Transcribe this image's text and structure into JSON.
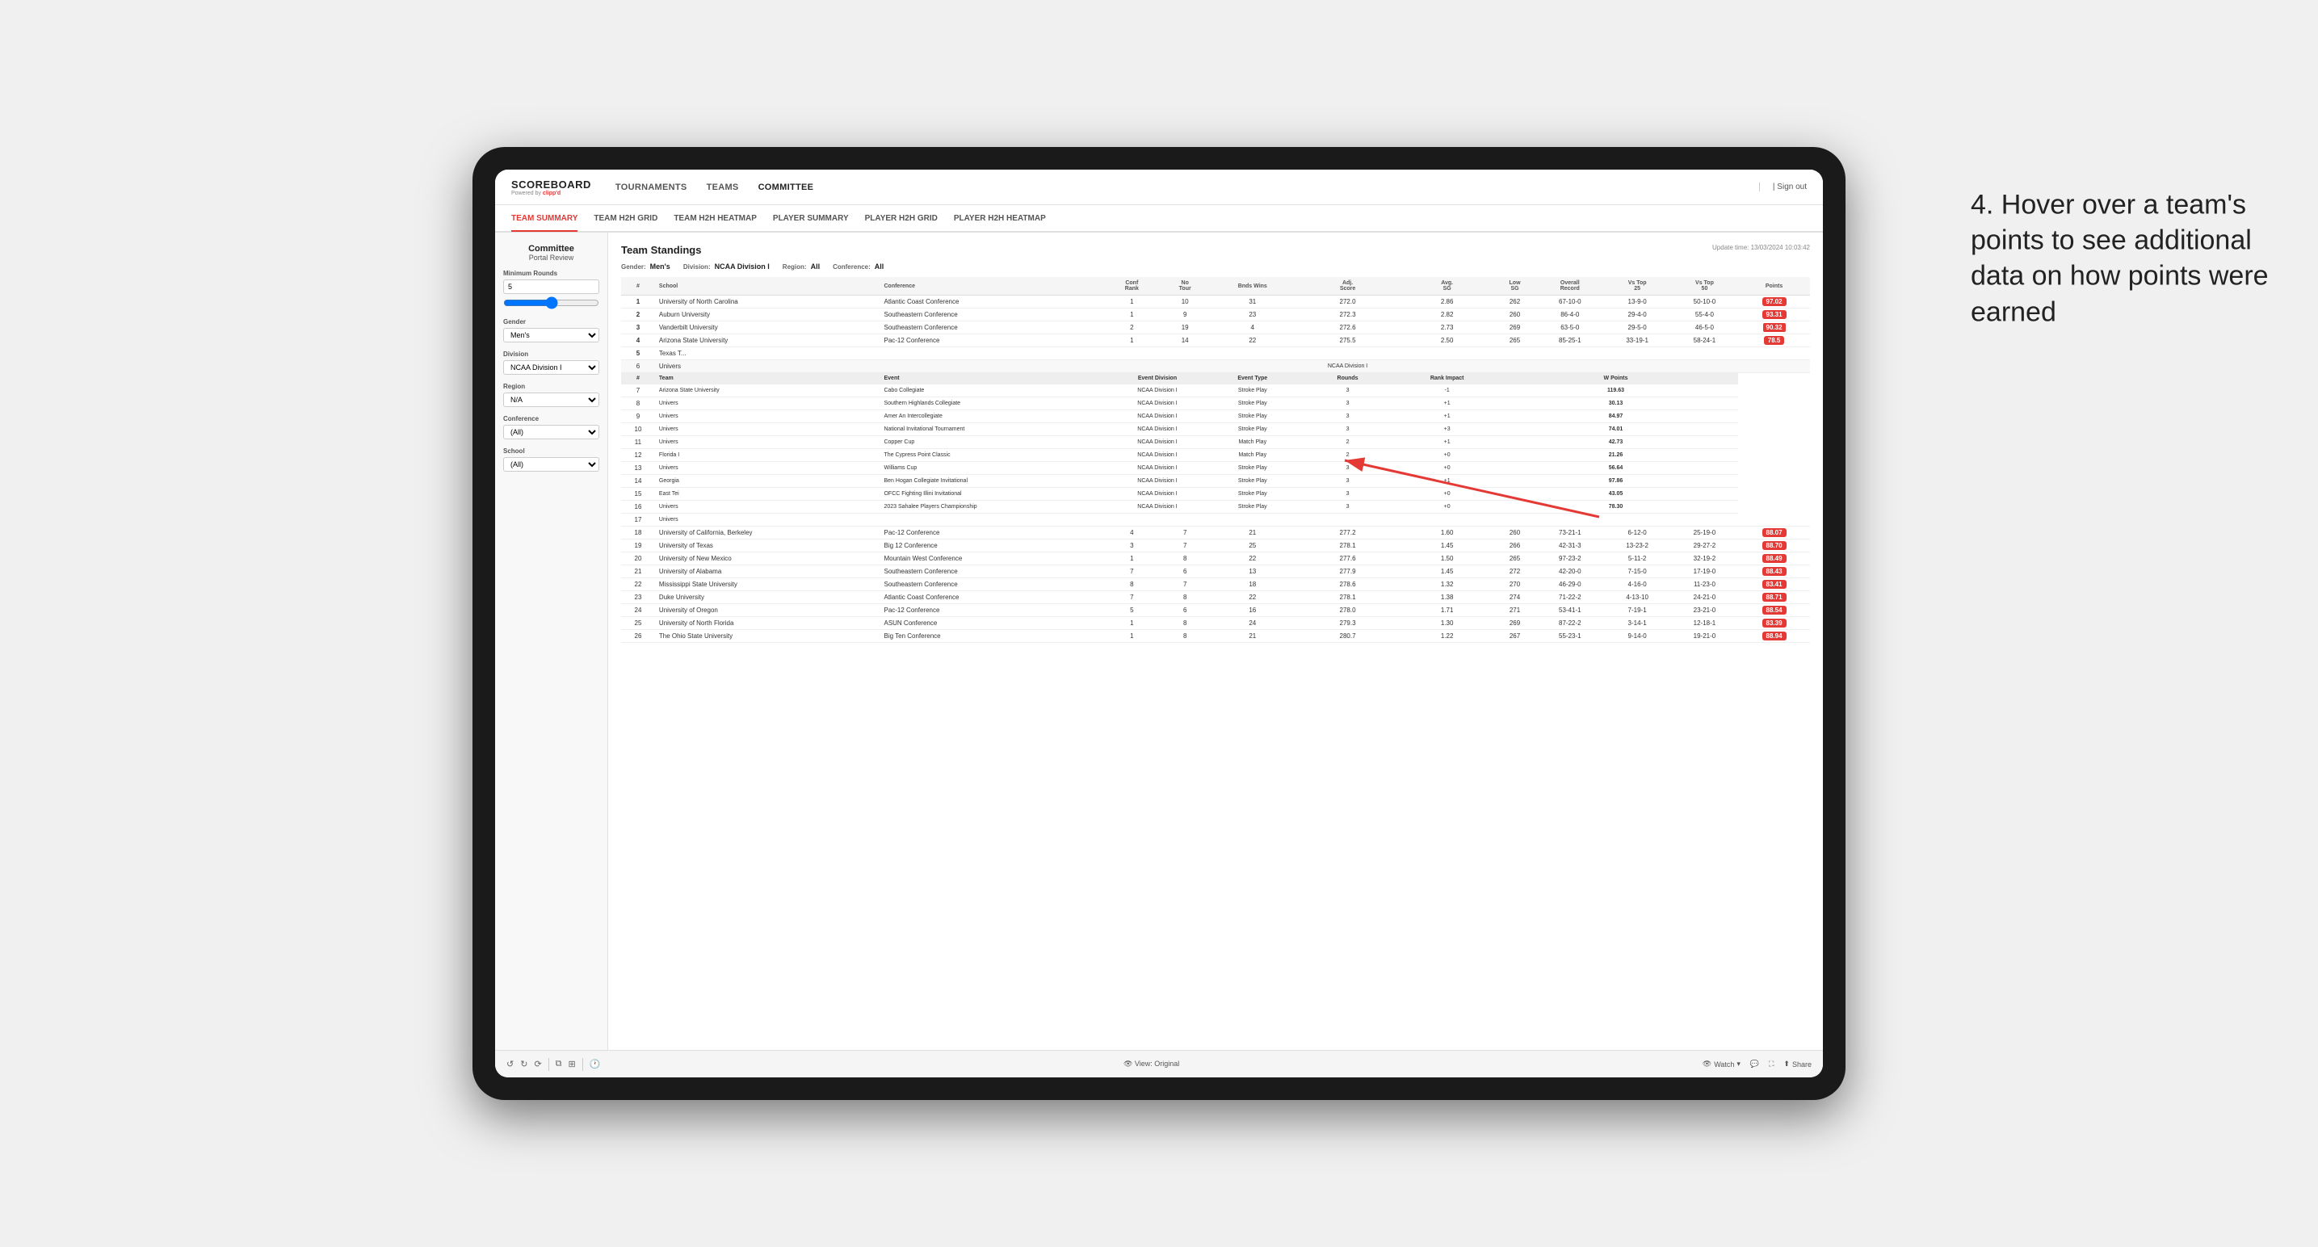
{
  "app": {
    "logo": "SCOREBOARD",
    "powered_by": "Powered by clipp'd",
    "sign_out": "Sign out"
  },
  "nav": {
    "items": [
      {
        "label": "TOURNAMENTS",
        "active": false
      },
      {
        "label": "TEAMS",
        "active": false
      },
      {
        "label": "COMMITTEE",
        "active": true
      }
    ]
  },
  "sub_nav": {
    "items": [
      {
        "label": "TEAM SUMMARY",
        "active": true
      },
      {
        "label": "TEAM H2H GRID",
        "active": false
      },
      {
        "label": "TEAM H2H HEATMAP",
        "active": false
      },
      {
        "label": "PLAYER SUMMARY",
        "active": false
      },
      {
        "label": "PLAYER H2H GRID",
        "active": false
      },
      {
        "label": "PLAYER H2H HEATMAP",
        "active": false
      }
    ]
  },
  "sidebar": {
    "committee_portal_label": "Committee",
    "portal_review_label": "Portal Review",
    "sections": [
      {
        "title": "Minimum Rounds",
        "value": "5"
      },
      {
        "title": "Gender",
        "options": [
          "Men's"
        ]
      },
      {
        "title": "Division",
        "options": [
          "NCAA Division I"
        ]
      },
      {
        "title": "Region",
        "options": [
          "N/A"
        ]
      },
      {
        "title": "Conference",
        "options": [
          "(All)"
        ]
      },
      {
        "title": "School",
        "options": [
          "(All)"
        ]
      }
    ]
  },
  "panel": {
    "title": "Team Standings",
    "update_time": "Update time: 13/03/2024 10:03:42",
    "filters": {
      "gender_label": "Gender:",
      "gender_value": "Men's",
      "division_label": "Division:",
      "division_value": "NCAA Division I",
      "region_label": "Region:",
      "region_value": "All",
      "conference_label": "Conference:",
      "conference_value": "All"
    },
    "table_headers": [
      "#",
      "School",
      "Conference",
      "Conf Rank",
      "No Tour",
      "Bnds Wins",
      "Adj. Score",
      "Avg. SG",
      "Low SG",
      "Overall Record",
      "Vs Top 25",
      "Vs Top 50",
      "Points"
    ],
    "rows": [
      {
        "rank": 1,
        "school": "University of North Carolina",
        "conference": "Atlantic Coast Conference",
        "conf_rank": 1,
        "no_tour": 10,
        "bnds_wins": 31,
        "adj_score": 272.0,
        "avg_sg": 2.86,
        "low_sg": 262,
        "overall_record": "67-10-0",
        "vs_top25": "13-9-0",
        "vs_top50": "50-10-0",
        "points": "97.02",
        "highlighted": false
      },
      {
        "rank": 2,
        "school": "Auburn University",
        "conference": "Southeastern Conference",
        "conf_rank": 1,
        "no_tour": 9,
        "bnds_wins": 23,
        "adj_score": 272.3,
        "avg_sg": 2.82,
        "low_sg": 260,
        "overall_record": "86-4-0",
        "vs_top25": "29-4-0",
        "vs_top50": "55-4-0",
        "points": "93.31",
        "highlighted": false
      },
      {
        "rank": 3,
        "school": "Vanderbilt University",
        "conference": "Southeastern Conference",
        "conf_rank": 2,
        "no_tour": 19,
        "bnds_wins": 4,
        "adj_score": 272.6,
        "avg_sg": 2.73,
        "low_sg": 269,
        "overall_record": "63-5-0",
        "vs_top25": "29-5-0",
        "vs_top50": "46-5-0",
        "points": "90.32",
        "highlighted": true
      },
      {
        "rank": 4,
        "school": "Arizona State University",
        "conference": "Pac-12 Conference",
        "conf_rank": 1,
        "no_tour": 14,
        "bnds_wins": 22,
        "adj_score": 275.5,
        "avg_sg": 2.5,
        "low_sg": 265,
        "overall_record": "85-25-1",
        "vs_top25": "33-19-1",
        "vs_top50": "58-24-1",
        "points": "78.5",
        "highlighted": false
      },
      {
        "rank": 5,
        "school": "Texas T...",
        "conference": "",
        "conf_rank": "",
        "no_tour": "",
        "bnds_wins": "",
        "adj_score": "",
        "avg_sg": "",
        "low_sg": "",
        "overall_record": "",
        "vs_top25": "",
        "vs_top50": "",
        "points": "",
        "highlighted": false
      }
    ],
    "detail_rows": [
      {
        "row_num": 6,
        "team": "Univers",
        "event": "",
        "event_division": "NCAA Division I",
        "event_type": "",
        "rounds": "",
        "rank_impact": "",
        "w_points": ""
      },
      {
        "row_num": 7,
        "team": "Arizona State University",
        "event": "Cabo Collegiate",
        "event_division": "NCAA Division I",
        "event_type": "Stroke Play",
        "rounds": 3,
        "rank_impact": "-1",
        "w_points": "119.63"
      },
      {
        "row_num": 8,
        "team": "Univers",
        "event": "Southern Highlands Collegiate",
        "event_division": "NCAA Division I",
        "event_type": "Stroke Play",
        "rounds": 3,
        "rank_impact": "+1",
        "w_points": "30.13"
      },
      {
        "row_num": 9,
        "team": "Univers",
        "event": "Amer An Intercollegiate",
        "event_division": "NCAA Division I",
        "event_type": "Stroke Play",
        "rounds": 3,
        "rank_impact": "+1",
        "w_points": "84.97"
      },
      {
        "row_num": 10,
        "team": "Univers",
        "event": "National Invitational Tournament",
        "event_division": "NCAA Division I",
        "event_type": "Stroke Play",
        "rounds": 3,
        "rank_impact": "+3",
        "w_points": "74.01"
      },
      {
        "row_num": 11,
        "team": "Univers",
        "event": "Copper Cup",
        "event_division": "NCAA Division I",
        "event_type": "Match Play",
        "rounds": 2,
        "rank_impact": "+1",
        "w_points": "42.73"
      },
      {
        "row_num": 12,
        "team": "Florida I",
        "event": "The Cypress Point Classic",
        "event_division": "NCAA Division I",
        "event_type": "Match Play",
        "rounds": 2,
        "rank_impact": "+0",
        "w_points": "21.26"
      },
      {
        "row_num": 13,
        "team": "Univers",
        "event": "Williams Cup",
        "event_division": "NCAA Division I",
        "event_type": "Stroke Play",
        "rounds": 3,
        "rank_impact": "+0",
        "w_points": "56.64"
      },
      {
        "row_num": 14,
        "team": "Georgia",
        "event": "Ben Hogan Collegiate Invitational",
        "event_division": "NCAA Division I",
        "event_type": "Stroke Play",
        "rounds": 3,
        "rank_impact": "+1",
        "w_points": "97.86"
      },
      {
        "row_num": 15,
        "team": "East Tei",
        "event": "OFCC Fighting Illini Invitational",
        "event_division": "NCAA Division I",
        "event_type": "Stroke Play",
        "rounds": 3,
        "rank_impact": "+0",
        "w_points": "43.05"
      },
      {
        "row_num": 16,
        "team": "Univers",
        "event": "2023 Sahalee Players Championship",
        "event_division": "NCAA Division I",
        "event_type": "Stroke Play",
        "rounds": 3,
        "rank_impact": "+0",
        "w_points": "78.30"
      },
      {
        "row_num": 17,
        "team": "Univers",
        "event": "",
        "event_division": "",
        "event_type": "",
        "rounds": "",
        "rank_impact": "",
        "w_points": ""
      }
    ],
    "lower_rows": [
      {
        "rank": 18,
        "school": "University of California, Berkeley",
        "conference": "Pac-12 Conference",
        "conf_rank": 4,
        "no_tour": 7,
        "bnds_wins": 21,
        "adj_score": 277.2,
        "avg_sg": 1.6,
        "low_sg": 260,
        "overall_record": "73-21-1",
        "vs_top25": "6-12-0",
        "vs_top50": "25-19-0",
        "points": "88.07"
      },
      {
        "rank": 19,
        "school": "University of Texas",
        "conference": "Big 12 Conference",
        "conf_rank": 3,
        "no_tour": 7,
        "bnds_wins": 25,
        "adj_score": 278.1,
        "avg_sg": 1.45,
        "low_sg": 266,
        "overall_record": "42-31-3",
        "vs_top25": "13-23-2",
        "vs_top50": "29-27-2",
        "points": "88.70"
      },
      {
        "rank": 20,
        "school": "University of New Mexico",
        "conference": "Mountain West Conference",
        "conf_rank": 1,
        "no_tour": 8,
        "bnds_wins": 22,
        "adj_score": 277.6,
        "avg_sg": 1.5,
        "low_sg": 265,
        "overall_record": "97-23-2",
        "vs_top25": "5-11-2",
        "vs_top50": "32-19-2",
        "points": "88.49"
      },
      {
        "rank": 21,
        "school": "University of Alabama",
        "conference": "Southeastern Conference",
        "conf_rank": 7,
        "no_tour": 6,
        "bnds_wins": 13,
        "adj_score": 277.9,
        "avg_sg": 1.45,
        "low_sg": 272,
        "overall_record": "42-20-0",
        "vs_top25": "7-15-0",
        "vs_top50": "17-19-0",
        "points": "88.43"
      },
      {
        "rank": 22,
        "school": "Mississippi State University",
        "conference": "Southeastern Conference",
        "conf_rank": 8,
        "no_tour": 7,
        "bnds_wins": 18,
        "adj_score": 278.6,
        "avg_sg": 1.32,
        "low_sg": 270,
        "overall_record": "46-29-0",
        "vs_top25": "4-16-0",
        "vs_top50": "11-23-0",
        "points": "83.41"
      },
      {
        "rank": 23,
        "school": "Duke University",
        "conference": "Atlantic Coast Conference",
        "conf_rank": 7,
        "no_tour": 8,
        "bnds_wins": 22,
        "adj_score": 278.1,
        "avg_sg": 1.38,
        "low_sg": 274,
        "overall_record": "71-22-2",
        "vs_top25": "4-13-10",
        "vs_top50": "24-21-0",
        "points": "88.71"
      },
      {
        "rank": 24,
        "school": "University of Oregon",
        "conference": "Pac-12 Conference",
        "conf_rank": 5,
        "no_tour": 6,
        "bnds_wins": 16,
        "adj_score": 278.0,
        "avg_sg": 1.71,
        "low_sg": 271,
        "overall_record": "53-41-1",
        "vs_top25": "7-19-1",
        "vs_top50": "23-21-0",
        "points": "88.54"
      },
      {
        "rank": 25,
        "school": "University of North Florida",
        "conference": "ASUN Conference",
        "conf_rank": 1,
        "no_tour": 8,
        "bnds_wins": 24,
        "adj_score": 279.3,
        "avg_sg": 1.3,
        "low_sg": 269,
        "overall_record": "87-22-2",
        "vs_top25": "3-14-1",
        "vs_top50": "12-18-1",
        "points": "83.39"
      },
      {
        "rank": 26,
        "school": "The Ohio State University",
        "conference": "Big Ten Conference",
        "conf_rank": 1,
        "no_tour": 8,
        "bnds_wins": 21,
        "adj_score": 280.7,
        "avg_sg": 1.22,
        "low_sg": 267,
        "overall_record": "55-23-1",
        "vs_top25": "9-14-0",
        "vs_top50": "19-21-0",
        "points": "88.94"
      }
    ]
  },
  "toolbar": {
    "view_label": "View: Original",
    "watch_label": "Watch",
    "share_label": "Share"
  },
  "annotation": {
    "text": "4. Hover over a team's points to see additional data on how points were earned"
  }
}
